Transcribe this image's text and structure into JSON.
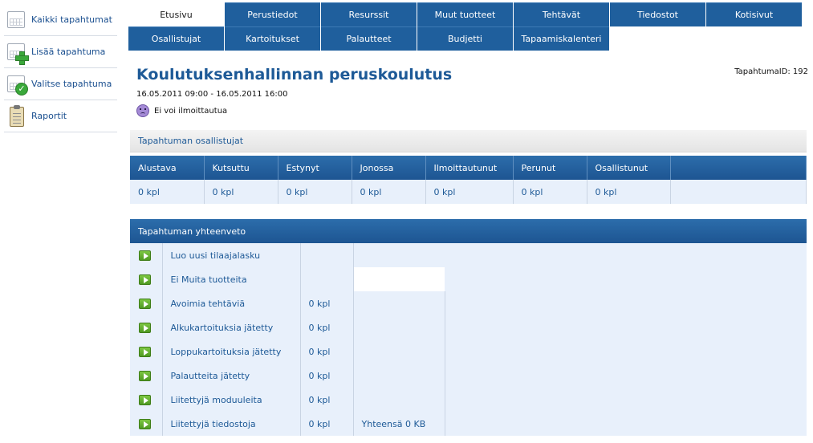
{
  "sidebar": {
    "items": [
      {
        "label": "Kaikki tapahtumat",
        "icon": "calendar-icon"
      },
      {
        "label": "Lisää tapahtuma",
        "icon": "calendar-add-icon"
      },
      {
        "label": "Valitse tapahtuma",
        "icon": "calendar-check-icon"
      },
      {
        "label": "Raportit",
        "icon": "clipboard-icon"
      }
    ]
  },
  "tabs": {
    "row1": [
      "Etusivu",
      "Perustiedot",
      "Resurssit",
      "Muut tuotteet",
      "Tehtävät",
      "Tiedostot",
      "Kotisivut"
    ],
    "row2": [
      "Osallistujat",
      "Kartoitukset",
      "Palautteet",
      "Budjetti",
      "Tapaamiskalenteri"
    ],
    "active": "Etusivu"
  },
  "event": {
    "title": "Koulutuksenhallinnan peruskoulutus",
    "id_label": "TapahtumaID: 192",
    "date": "16.05.2011 09:00 - 16.05.2011 16:00",
    "registration_status": "Ei voi ilmoittautua"
  },
  "participants": {
    "heading": "Tapahtuman osallistujat",
    "columns": [
      "Alustava",
      "Kutsuttu",
      "Estynyt",
      "Jonossa",
      "Ilmoittautunut",
      "Perunut",
      "Osallistunut"
    ],
    "values": [
      "0 kpl",
      "0 kpl",
      "0 kpl",
      "0 kpl",
      "0 kpl",
      "0 kpl",
      "0 kpl"
    ]
  },
  "summary": {
    "heading": "Tapahtuman yhteenveto",
    "rows": [
      {
        "label": "Luo uusi tilaajalasku",
        "count": "",
        "extra": ""
      },
      {
        "label": "Ei Muita tuotteita",
        "count": "",
        "extra": ""
      },
      {
        "label": "Avoimia tehtäviä",
        "count": "0 kpl",
        "extra": ""
      },
      {
        "label": "Alkukartoituksia jätetty",
        "count": "0 kpl",
        "extra": ""
      },
      {
        "label": "Loppukartoituksia jätetty",
        "count": "0 kpl",
        "extra": ""
      },
      {
        "label": "Palautteita jätetty",
        "count": "0 kpl",
        "extra": ""
      },
      {
        "label": "Liitettyjä moduuleita",
        "count": "0 kpl",
        "extra": ""
      },
      {
        "label": "Liitettyjä tiedostoja",
        "count": "0 kpl",
        "extra": "Yhteensä 0 KB"
      }
    ]
  },
  "colors": {
    "brand_blue": "#1f5f9d",
    "title_blue": "#1e5a97",
    "row_background": "#e8f0fb",
    "play_green": "#5fae2e"
  }
}
